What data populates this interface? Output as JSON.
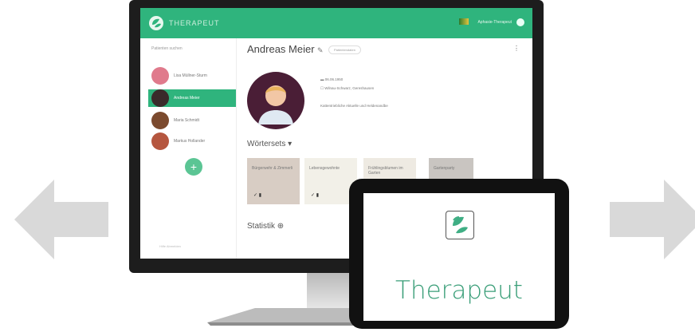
{
  "app": {
    "name": "THERAPEUT",
    "user": "Aphasie-Therapeut"
  },
  "sidebar": {
    "title": "Patienten suchen",
    "patients": [
      {
        "name": "Lisa Müllner-Sturm"
      },
      {
        "name": "Andreas Meier"
      },
      {
        "name": "Maria Schmidt"
      },
      {
        "name": "Markus Hollander"
      }
    ],
    "add_label": "+",
    "footer": "Hilfe    Abmelden"
  },
  "main": {
    "patient_name": "Andreas Meier",
    "edit_icon": "✎",
    "info_pill": "Patientendaten",
    "menu_icon": "⋮",
    "birthdate": "▬ 06.06.1950",
    "address": "☐ Wilnau-Schwarz, Gereshausen",
    "diagnosis": "Kattentriebliche Aktuelle und Heldenandbe",
    "wortersets_title": "Wörtersets  ▾",
    "cards": [
      {
        "label": "Bürgerwehr & Zimmerli",
        "actions": "✓  ▮"
      },
      {
        "label": "Lebensgewohnte",
        "actions": "✓  ▮"
      },
      {
        "label": "Frühlingsblumen im Garten",
        "actions": ""
      },
      {
        "label": "Gartenparty",
        "actions": ""
      }
    ],
    "statistik_title": "Statistik  ⊕"
  },
  "tablet": {
    "label": "Therapeut"
  },
  "colors": {
    "brand_green": "#2fb47d",
    "tablet_text": "#3a9e78",
    "arrow_gray": "#d9d9d9"
  },
  "icons": {
    "left_arrow": "arrow-left-icon",
    "right_arrow": "arrow-right-icon",
    "logo": "leaf-logo-icon"
  }
}
